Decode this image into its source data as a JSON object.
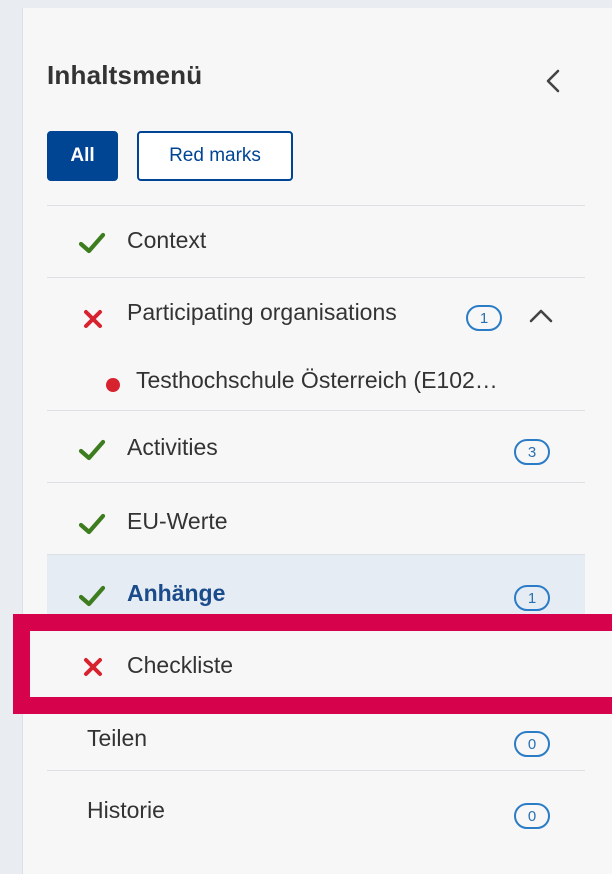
{
  "panel": {
    "title": "Inhaltsmenü"
  },
  "filters": {
    "all_label": "All",
    "red_marks_label": "Red marks",
    "active": "All"
  },
  "menu": {
    "items": [
      {
        "label": "Context",
        "status": "ok"
      },
      {
        "label": "Participating organisations",
        "status": "error",
        "count": "1",
        "expanded": true,
        "children": [
          {
            "label": "Testhochschule Österreich (E102…",
            "status": "error"
          }
        ]
      },
      {
        "label": "Activities",
        "status": "ok",
        "count": "3"
      },
      {
        "label": "EU-Werte",
        "status": "ok"
      },
      {
        "label": "Anhänge",
        "status": "ok",
        "count": "1",
        "active": true
      },
      {
        "label": "Checkliste",
        "status": "error"
      },
      {
        "label": "Teilen",
        "status": "none",
        "count": "0"
      },
      {
        "label": "Historie",
        "status": "none",
        "count": "0"
      }
    ]
  },
  "colors": {
    "primary": "#004494",
    "ok": "#3e7d1f",
    "error": "#d7232f",
    "badge": "#2b7cc7",
    "highlight": "#d6024c",
    "active_row": "#e5ecf4"
  },
  "icons": {
    "collapse": "chevron-left-icon",
    "ok": "checkmark-icon",
    "error": "cross-icon",
    "expand": "chevron-up-icon",
    "child": "red-dot-icon"
  }
}
